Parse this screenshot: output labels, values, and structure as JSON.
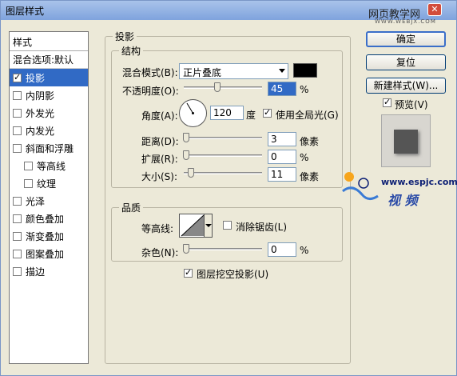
{
  "window": {
    "title": "图层样式",
    "watermark_top": "网页教学网",
    "watermark_top_sub": "WWW.WEBJX.COM",
    "close_glyph": "✕"
  },
  "stylelist": {
    "header": "样式",
    "blend": "混合选项:默认",
    "items": [
      {
        "label": "投影",
        "checked": true,
        "selected": true,
        "indent": false
      },
      {
        "label": "内阴影",
        "checked": false,
        "selected": false,
        "indent": false
      },
      {
        "label": "外发光",
        "checked": false,
        "selected": false,
        "indent": false
      },
      {
        "label": "内发光",
        "checked": false,
        "selected": false,
        "indent": false
      },
      {
        "label": "斜面和浮雕",
        "checked": false,
        "selected": false,
        "indent": false
      },
      {
        "label": "等高线",
        "checked": false,
        "selected": false,
        "indent": true
      },
      {
        "label": "纹理",
        "checked": false,
        "selected": false,
        "indent": true
      },
      {
        "label": "光泽",
        "checked": false,
        "selected": false,
        "indent": false
      },
      {
        "label": "颜色叠加",
        "checked": false,
        "selected": false,
        "indent": false
      },
      {
        "label": "渐变叠加",
        "checked": false,
        "selected": false,
        "indent": false
      },
      {
        "label": "图案叠加",
        "checked": false,
        "selected": false,
        "indent": false
      },
      {
        "label": "描边",
        "checked": false,
        "selected": false,
        "indent": false
      }
    ]
  },
  "shadow": {
    "section_title": "投影",
    "structure_title": "结构",
    "blend_mode_label": "混合模式(B):",
    "blend_mode_value": "正片叠底",
    "blend_color": "#000000",
    "opacity_label": "不透明度(O):",
    "opacity_value": "45",
    "opacity_unit": "%",
    "angle_label": "角度(A):",
    "angle_value": "120",
    "angle_unit": "度",
    "global_light_label": "使用全局光(G)",
    "global_light_checked": true,
    "distance_label": "距离(D):",
    "distance_value": "3",
    "distance_unit": "像素",
    "spread_label": "扩展(R):",
    "spread_value": "0",
    "spread_unit": "%",
    "size_label": "大小(S):",
    "size_value": "11",
    "size_unit": "像素",
    "quality_title": "品质",
    "contour_label": "等高线:",
    "antialias_label": "消除锯齿(L)",
    "antialias_checked": false,
    "noise_label": "杂色(N):",
    "noise_value": "0",
    "noise_unit": "%",
    "knockout_label": "图层挖空投影(U)",
    "knockout_checked": true
  },
  "buttons": {
    "ok": "确定",
    "reset": "复位",
    "new_style": "新建样式(W)...",
    "preview_label": "预览(V)",
    "preview_checked": true
  },
  "watermark": {
    "url": "www.espjc.com",
    "cn": "视 频"
  },
  "colors": {
    "selection": "#316ac5",
    "dialog_bg": "#ece9d8"
  }
}
